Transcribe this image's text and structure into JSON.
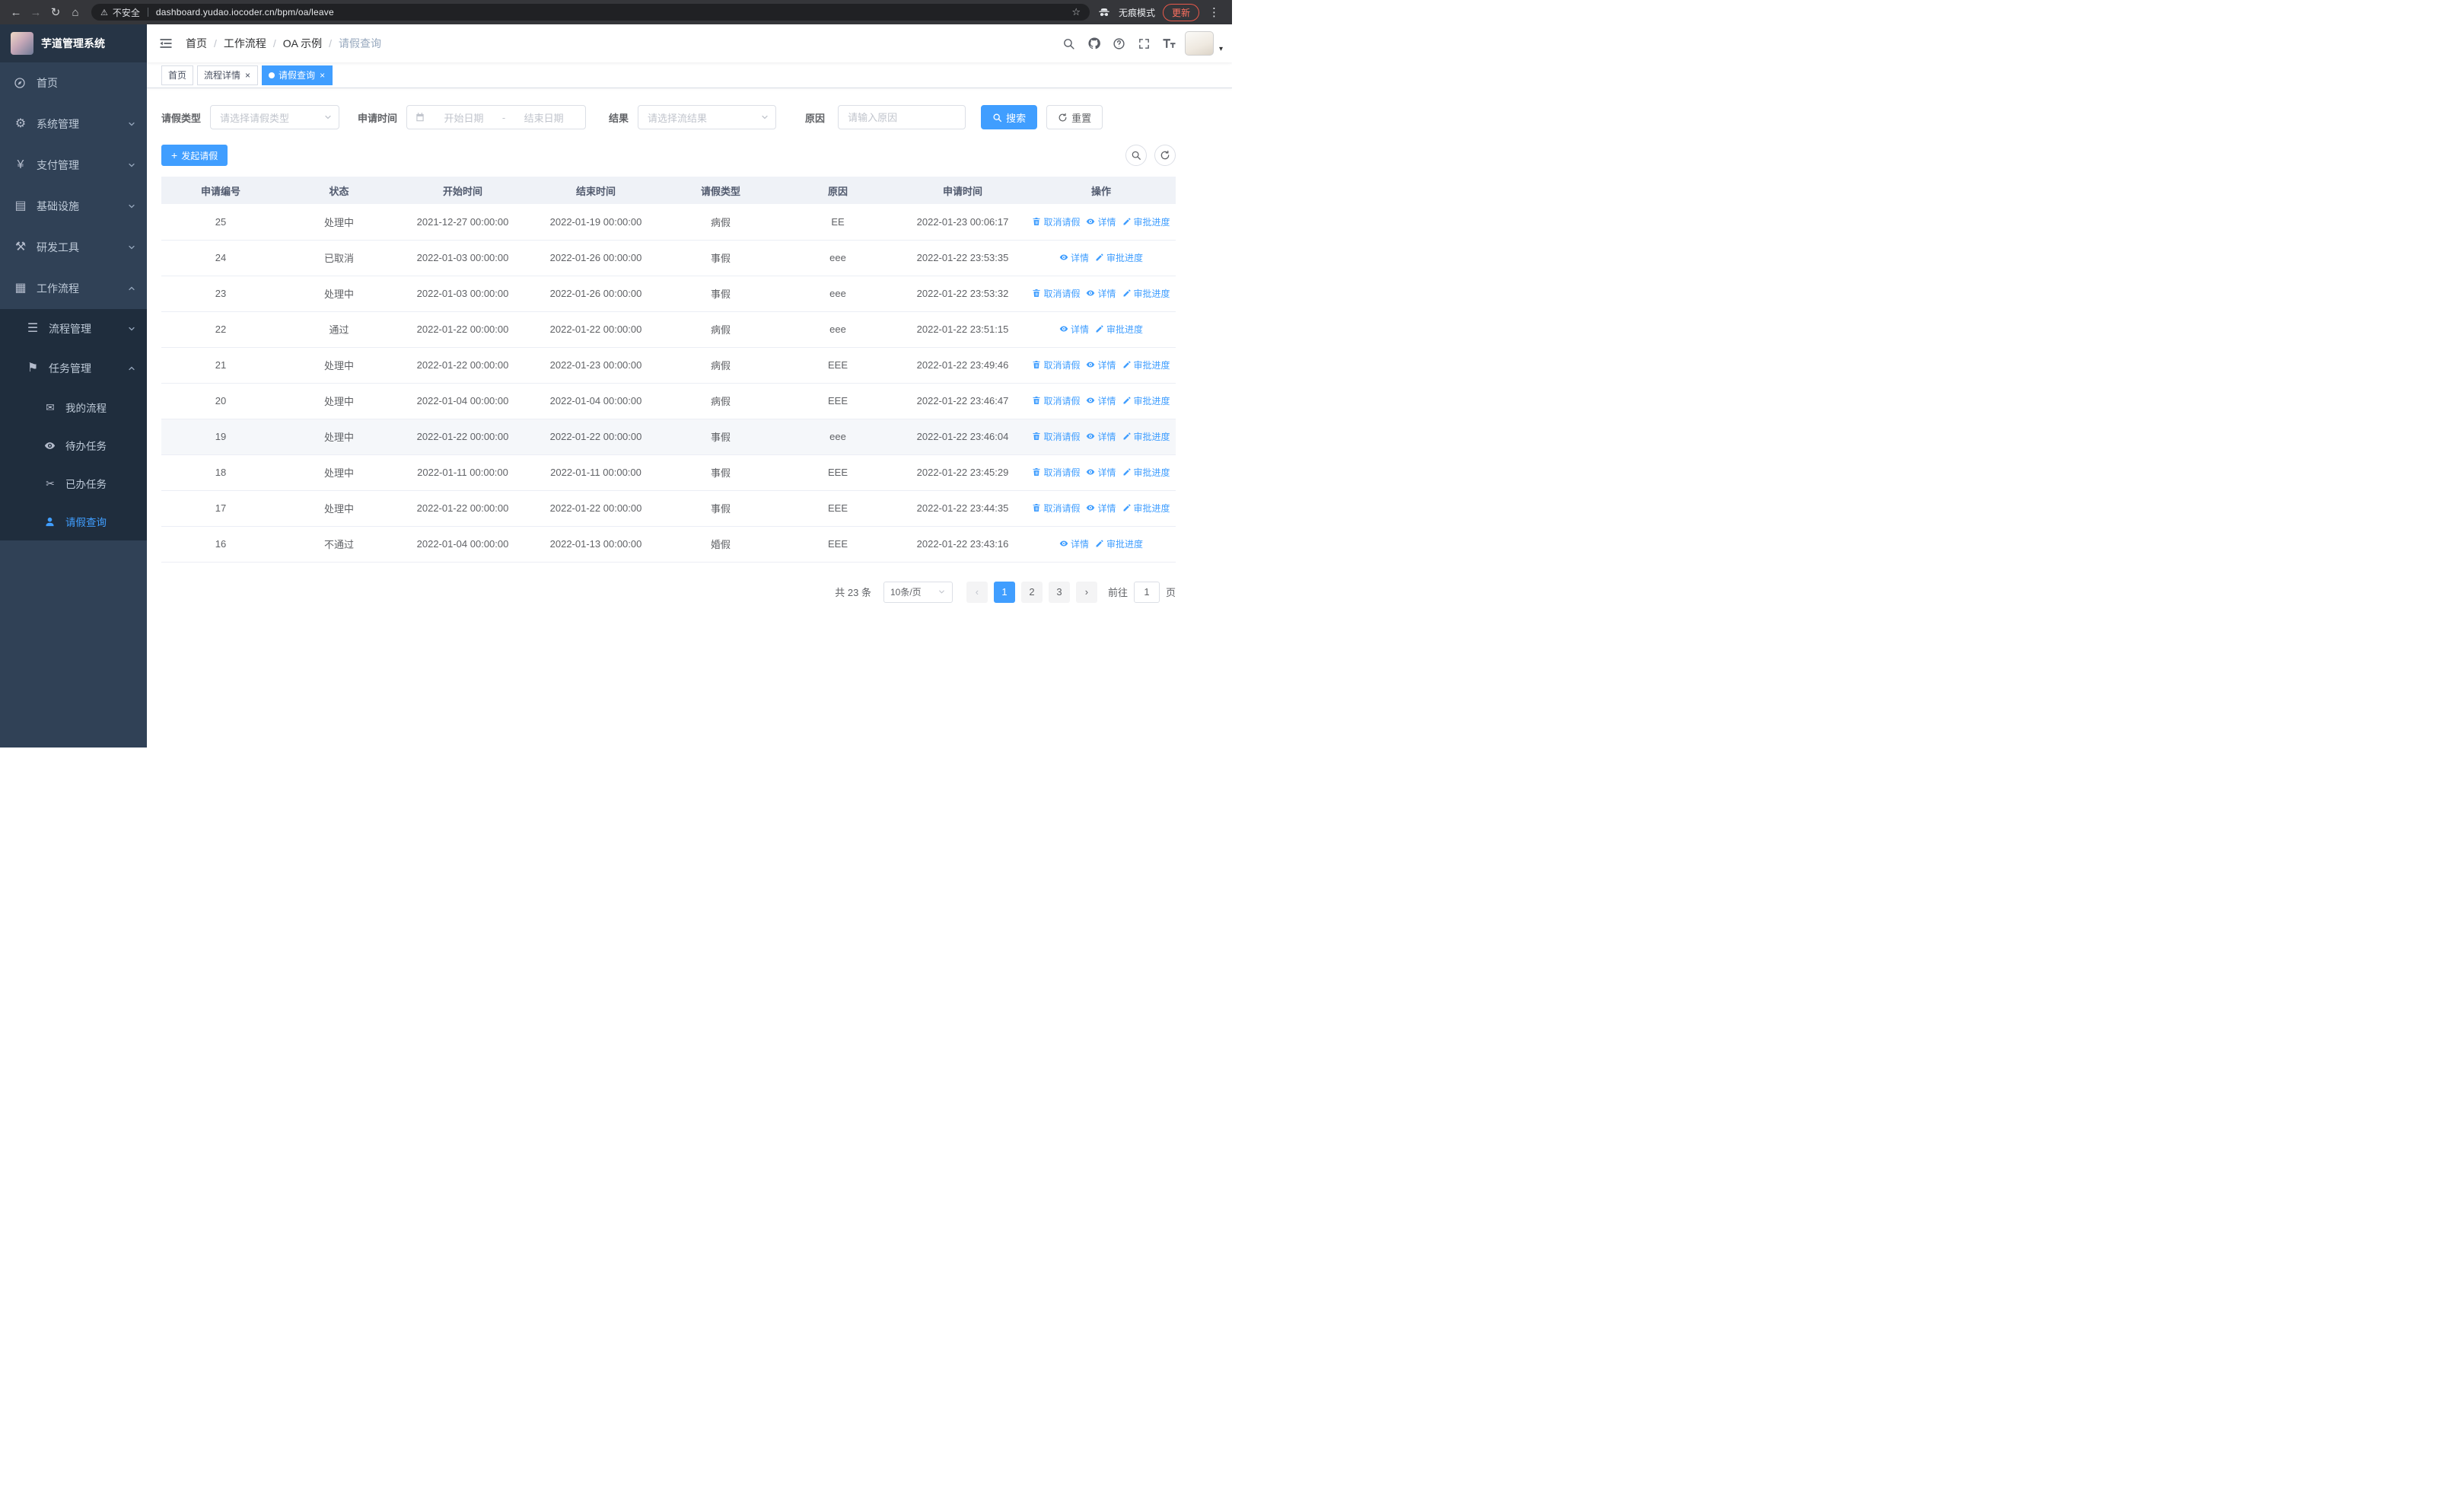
{
  "browser": {
    "security": "不安全",
    "url": "dashboard.yudao.iocoder.cn/bpm/oa/leave",
    "incognito": "无痕模式",
    "update": "更新"
  },
  "icons": {
    "back": "←",
    "forward": "→",
    "reload": "↻",
    "home": "⌂",
    "warning": "⚠",
    "star": "☆",
    "menu_dots": "⋮",
    "gear": "⚙",
    "yen": "¥",
    "infrastructure": "▤",
    "tools": "⚒",
    "workflow": "▦",
    "list": "☰",
    "flag": "⚑",
    "message": "✉",
    "finished": "✂",
    "plus": "+",
    "prev": "‹",
    "next": "›",
    "caret": "▾",
    "close": "×"
  },
  "sidebar": {
    "title": "芋道管理系统",
    "items": [
      {
        "label": "首页",
        "icon": "compass-icon"
      },
      {
        "label": "系统管理",
        "icon": "gear-icon"
      },
      {
        "label": "支付管理",
        "icon": "yen-icon"
      },
      {
        "label": "基础设施",
        "icon": "monitor-icon"
      },
      {
        "label": "研发工具",
        "icon": "tools-icon"
      },
      {
        "label": "工作流程",
        "icon": "briefcase-icon",
        "expanded": true
      }
    ],
    "submenu": [
      {
        "label": "流程管理",
        "icon": "list-icon"
      },
      {
        "label": "任务管理",
        "icon": "flag-icon",
        "expanded": true
      }
    ],
    "leaves": [
      {
        "label": "我的流程",
        "icon": "message-icon"
      },
      {
        "label": "待办任务",
        "icon": "eye-icon"
      },
      {
        "label": "已办任务",
        "icon": "finished-icon"
      },
      {
        "label": "请假查询",
        "icon": "user-icon",
        "active": true
      }
    ]
  },
  "breadcrumb": {
    "separator": "/",
    "items": [
      "首页",
      "工作流程",
      "OA 示例",
      "请假查询"
    ]
  },
  "tabs": [
    {
      "label": "首页",
      "closable": false,
      "active": false
    },
    {
      "label": "流程详情",
      "closable": true,
      "active": false
    },
    {
      "label": "请假查询",
      "closable": true,
      "active": true
    }
  ],
  "filters": {
    "leave_type_label": "请假类型",
    "leave_type_placeholder": "请选择请假类型",
    "apply_time_label": "申请时间",
    "start_placeholder": "开始日期",
    "range_separator": "-",
    "end_placeholder": "结束日期",
    "result_label": "结果",
    "result_placeholder": "请选择流结果",
    "reason_label": "原因",
    "reason_placeholder": "请输入原因",
    "search": "搜索",
    "reset": "重置"
  },
  "toolbar": {
    "create": "发起请假"
  },
  "table": {
    "columns": [
      "申请编号",
      "状态",
      "开始时间",
      "结束时间",
      "请假类型",
      "原因",
      "申请时间",
      "操作"
    ],
    "actions": {
      "cancel": "取消请假",
      "detail": "详情",
      "progress": "审批进度"
    },
    "rows": [
      {
        "id": "25",
        "status": "处理中",
        "start": "2021-12-27 00:00:00",
        "end": "2022-01-19 00:00:00",
        "type": "病假",
        "reason": "EE",
        "applied": "2022-01-23 00:06:17",
        "actions": [
          "cancel",
          "detail",
          "progress"
        ]
      },
      {
        "id": "24",
        "status": "已取消",
        "start": "2022-01-03 00:00:00",
        "end": "2022-01-26 00:00:00",
        "type": "事假",
        "reason": "eee",
        "applied": "2022-01-22 23:53:35",
        "actions": [
          "detail",
          "progress"
        ]
      },
      {
        "id": "23",
        "status": "处理中",
        "start": "2022-01-03 00:00:00",
        "end": "2022-01-26 00:00:00",
        "type": "事假",
        "reason": "eee",
        "applied": "2022-01-22 23:53:32",
        "actions": [
          "cancel",
          "detail",
          "progress"
        ]
      },
      {
        "id": "22",
        "status": "通过",
        "start": "2022-01-22 00:00:00",
        "end": "2022-01-22 00:00:00",
        "type": "病假",
        "reason": "eee",
        "applied": "2022-01-22 23:51:15",
        "actions": [
          "detail",
          "progress"
        ]
      },
      {
        "id": "21",
        "status": "处理中",
        "start": "2022-01-22 00:00:00",
        "end": "2022-01-23 00:00:00",
        "type": "病假",
        "reason": "EEE",
        "applied": "2022-01-22 23:49:46",
        "actions": [
          "cancel",
          "detail",
          "progress"
        ]
      },
      {
        "id": "20",
        "status": "处理中",
        "start": "2022-01-04 00:00:00",
        "end": "2022-01-04 00:00:00",
        "type": "病假",
        "reason": "EEE",
        "applied": "2022-01-22 23:46:47",
        "actions": [
          "cancel",
          "detail",
          "progress"
        ]
      },
      {
        "id": "19",
        "status": "处理中",
        "start": "2022-01-22 00:00:00",
        "end": "2022-01-22 00:00:00",
        "type": "事假",
        "reason": "eee",
        "applied": "2022-01-22 23:46:04",
        "actions": [
          "cancel",
          "detail",
          "progress"
        ],
        "highlighted": true
      },
      {
        "id": "18",
        "status": "处理中",
        "start": "2022-01-11 00:00:00",
        "end": "2022-01-11 00:00:00",
        "type": "事假",
        "reason": "EEE",
        "applied": "2022-01-22 23:45:29",
        "actions": [
          "cancel",
          "detail",
          "progress"
        ]
      },
      {
        "id": "17",
        "status": "处理中",
        "start": "2022-01-22 00:00:00",
        "end": "2022-01-22 00:00:00",
        "type": "事假",
        "reason": "EEE",
        "applied": "2022-01-22 23:44:35",
        "actions": [
          "cancel",
          "detail",
          "progress"
        ]
      },
      {
        "id": "16",
        "status": "不通过",
        "start": "2022-01-04 00:00:00",
        "end": "2022-01-13 00:00:00",
        "type": "婚假",
        "reason": "EEE",
        "applied": "2022-01-22 23:43:16",
        "actions": [
          "detail",
          "progress"
        ]
      }
    ]
  },
  "pagination": {
    "total": "共 23 条",
    "page_size": "10条/页",
    "pages": [
      "1",
      "2",
      "3"
    ],
    "active": "1",
    "goto": "前往",
    "goto_value": "1",
    "unit": "页"
  },
  "colors": {
    "accent": "#409EFF",
    "sidebar_bg": "#304156",
    "submenu_bg": "#1f2d3d",
    "table_header_bg": "#eff2f7",
    "update_pill": "#ff7160"
  }
}
